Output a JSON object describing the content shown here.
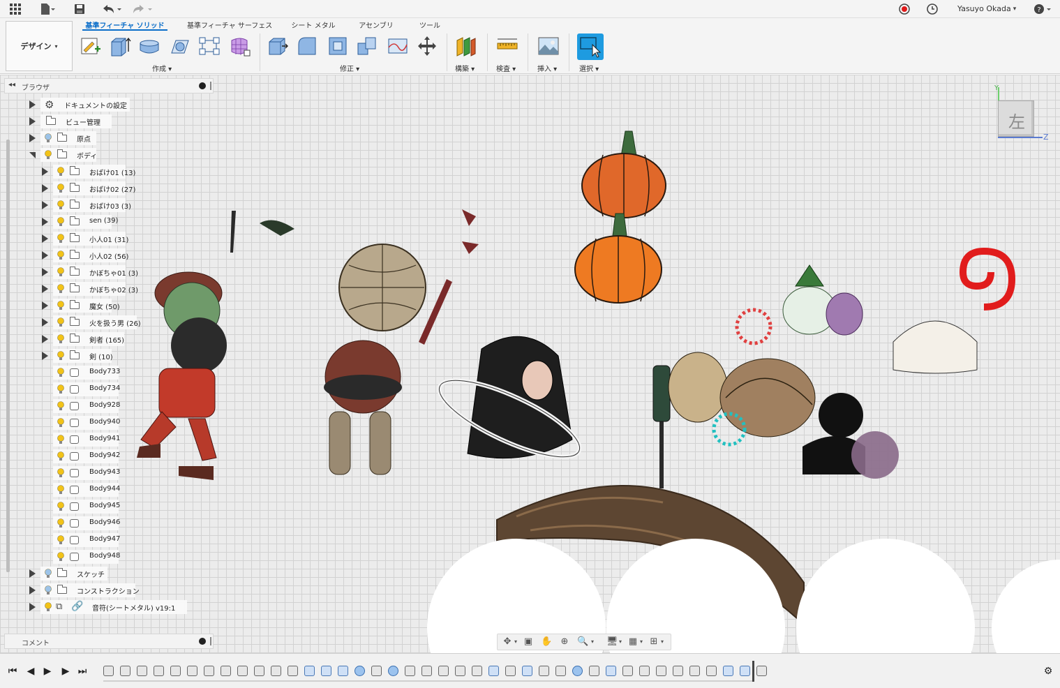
{
  "user": {
    "name": "Yasuyo Okada"
  },
  "design_button": {
    "label": "デザイン"
  },
  "tabs": [
    {
      "label": "基準フィーチャ ソリッド",
      "active": true
    },
    {
      "label": "基準フィーチャ サーフェス",
      "active": false
    },
    {
      "label": "シート メタル",
      "active": false
    },
    {
      "label": "アセンブリ",
      "active": false
    },
    {
      "label": "ツール",
      "active": false
    }
  ],
  "groups": {
    "create": "作成",
    "modify": "修正",
    "construct": "構築",
    "inspect": "検査",
    "insert": "挿入",
    "select": "選択"
  },
  "browser": {
    "title": "ブラウザ",
    "items": [
      {
        "label": "ドキュメントの設定"
      },
      {
        "label": "ビュー管理"
      },
      {
        "label": "原点"
      },
      {
        "label": "ボディ"
      },
      {
        "label": "おばけ01 (13)"
      },
      {
        "label": "おばけ02 (27)"
      },
      {
        "label": "おばけ03 (3)"
      },
      {
        "label": "sen (39)"
      },
      {
        "label": "小人01 (31)"
      },
      {
        "label": "小人02 (56)"
      },
      {
        "label": "かぼちゃ01 (3)"
      },
      {
        "label": "かぼちゃ02 (3)"
      },
      {
        "label": "魔女 (50)"
      },
      {
        "label": "火を扱う男 (26)"
      },
      {
        "label": "剣者 (165)"
      },
      {
        "label": "剣 (10)"
      },
      {
        "label": "Body733"
      },
      {
        "label": "Body734"
      },
      {
        "label": "Body928"
      },
      {
        "label": "Body940"
      },
      {
        "label": "Body941"
      },
      {
        "label": "Body942"
      },
      {
        "label": "Body943"
      },
      {
        "label": "Body944"
      },
      {
        "label": "Body945"
      },
      {
        "label": "Body946"
      },
      {
        "label": "Body947"
      },
      {
        "label": "Body948"
      },
      {
        "label": "スケッチ"
      },
      {
        "label": "コンストラクション"
      },
      {
        "label": "音符(シートメタル) v19:1"
      }
    ]
  },
  "comment": {
    "title": "コメント"
  },
  "viewcube": {
    "face_label": "左",
    "axis_y": "Y",
    "axis_z": "Z"
  },
  "colors": {
    "accent": "#0b6ec9",
    "select_tool": "#1e9be0"
  }
}
